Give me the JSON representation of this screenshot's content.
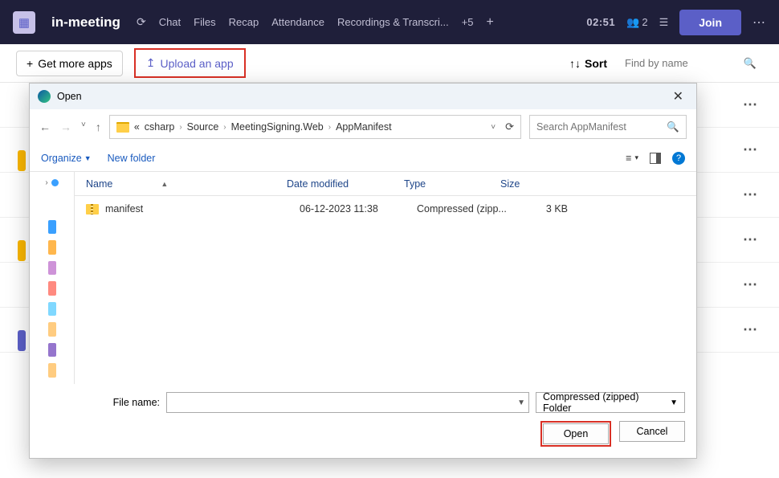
{
  "header": {
    "title": "in-meeting",
    "tabs": [
      "Chat",
      "Files",
      "Recap",
      "Attendance",
      "Recordings & Transcri..."
    ],
    "overflow": "+5",
    "timer": "02:51",
    "people_count": "2",
    "join": "Join"
  },
  "secbar": {
    "get_more": "Get more apps",
    "upload": "Upload an app",
    "sort": "Sort",
    "find_placeholder": "Find by name"
  },
  "dialog": {
    "title": "Open",
    "crumbs": [
      "csharp",
      "Source",
      "MeetingSigning.Web",
      "AppManifest"
    ],
    "crumb_prefix": "«",
    "search_placeholder": "Search AppManifest",
    "organize": "Organize",
    "new_folder": "New folder",
    "columns": {
      "name": "Name",
      "date": "Date modified",
      "type": "Type",
      "size": "Size"
    },
    "files": [
      {
        "name": "manifest",
        "date": "06-12-2023 11:38",
        "type": "Compressed (zipp...",
        "size": "3 KB"
      }
    ],
    "file_name_label": "File name:",
    "filter": "Compressed (zipped) Folder",
    "open": "Open",
    "cancel": "Cancel"
  }
}
